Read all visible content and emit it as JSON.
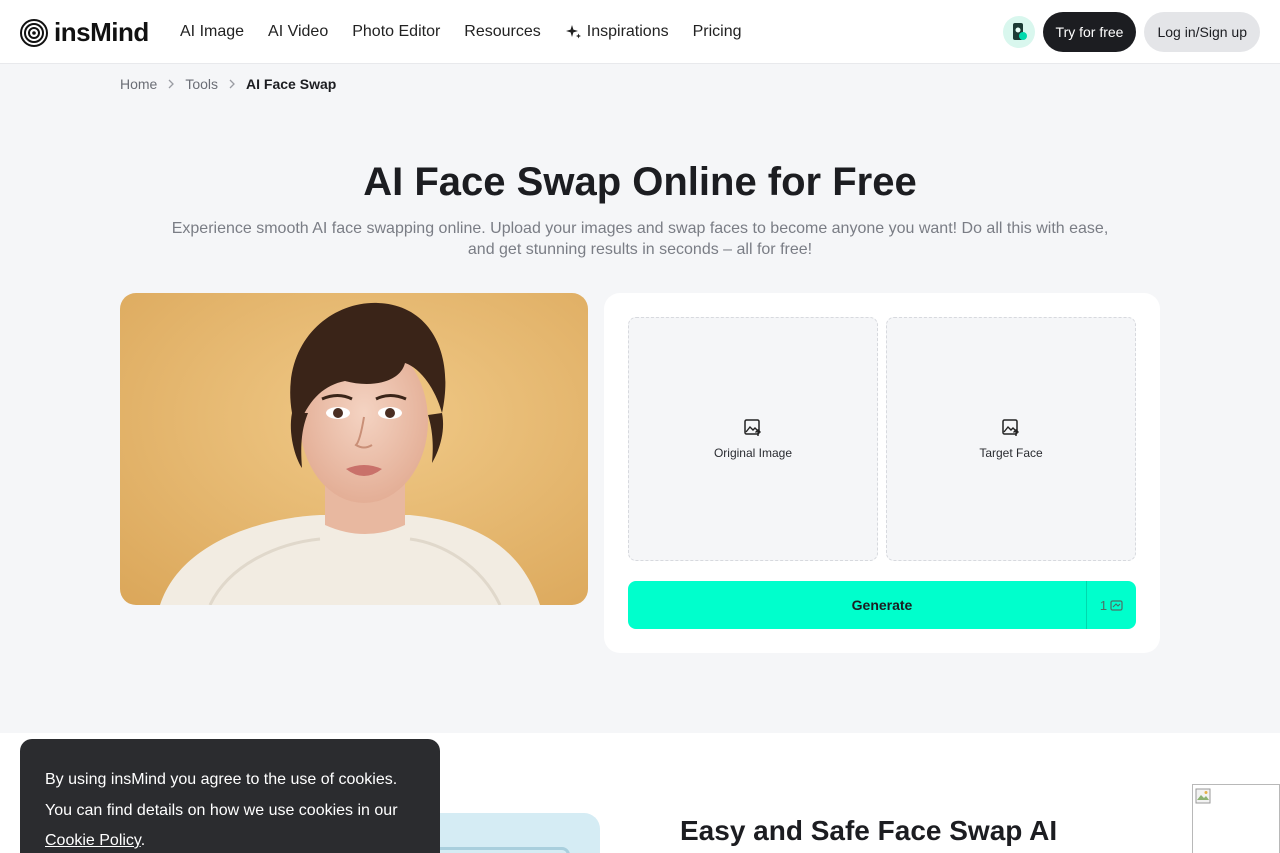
{
  "header": {
    "logo_text": "insMind",
    "nav": [
      {
        "label": "AI Image"
      },
      {
        "label": "AI Video"
      },
      {
        "label": "Photo Editor"
      },
      {
        "label": "Resources"
      },
      {
        "label": "Inspirations",
        "icon": "sparkle-icon"
      },
      {
        "label": "Pricing"
      }
    ],
    "try_label": "Try for free",
    "login_label": "Log in/Sign up"
  },
  "breadcrumb": {
    "items": [
      "Home",
      "Tools"
    ],
    "current": "AI Face Swap"
  },
  "hero": {
    "title": "AI Face Swap Online for Free",
    "subtitle_line1": "Experience smooth AI face swapping online. Upload your images and swap faces to become anyone you want! Do all this with ease,",
    "subtitle_line2": "and get stunning results in seconds – all for free!"
  },
  "tool": {
    "original_label": "Original Image",
    "target_label": "Target Face",
    "generate_label": "Generate",
    "credit_count": "1"
  },
  "lower": {
    "title": "Easy and Safe Face Swap AI"
  },
  "cookie": {
    "text_line1": "By using insMind you agree to the use of cookies.",
    "text_line2": "You can find details on how we use cookies in our",
    "link_label": "Cookie Policy",
    "suffix": "."
  },
  "colors": {
    "accent": "#00ffcc",
    "dark": "#1c1d21",
    "page_bg": "#f5f6f8"
  }
}
